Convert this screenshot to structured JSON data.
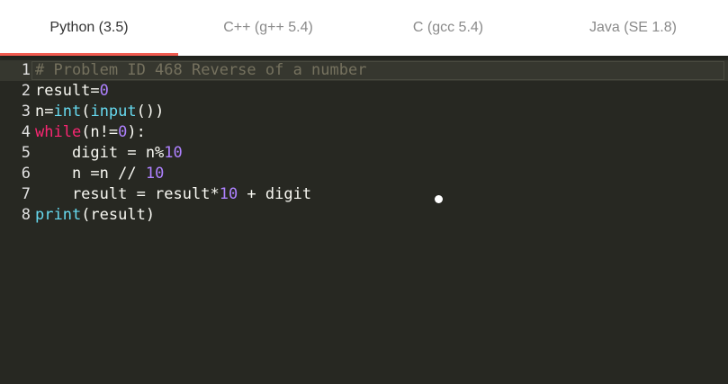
{
  "tabs": [
    {
      "label": "Python (3.5)",
      "active": true
    },
    {
      "label": "C++ (g++ 5.4)",
      "active": false
    },
    {
      "label": "C (gcc 5.4)",
      "active": false
    },
    {
      "label": "Java (SE 1.8)",
      "active": false
    }
  ],
  "editor": {
    "lines": [
      {
        "num": "1"
      },
      {
        "num": "2"
      },
      {
        "num": "3"
      },
      {
        "num": "4"
      },
      {
        "num": "5"
      },
      {
        "num": "6"
      },
      {
        "num": "7"
      },
      {
        "num": "8"
      }
    ],
    "tokens": {
      "l1_comment": "# Problem ID 468 Reverse of a number",
      "l2_a": "result=",
      "l2_num": "0",
      "l3_a": "n=",
      "l3_int": "int",
      "l3_b": "(",
      "l3_input": "input",
      "l3_c": "())",
      "l4_while": "while",
      "l4_a": "(n!=",
      "l4_num": "0",
      "l4_b": "):",
      "l5_a": "    digit = n%",
      "l5_num": "10",
      "l6_a": "    n =n // ",
      "l6_num": "10",
      "l7_a": "    result = result*",
      "l7_num": "10",
      "l7_b": " + digit",
      "l8_print": "print",
      "l8_a": "(result)"
    }
  },
  "colors": {
    "background": "#272822",
    "tab_accent": "#f05a4f",
    "keyword": "#f92672",
    "builtin": "#66d9ef",
    "number": "#ae81ff",
    "comment": "#75715e"
  }
}
